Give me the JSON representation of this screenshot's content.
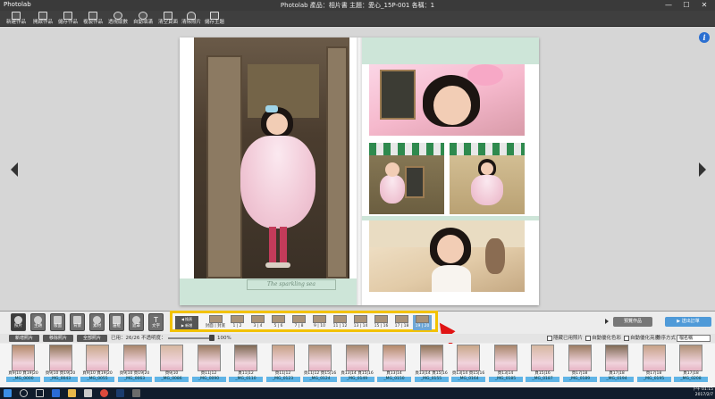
{
  "window": {
    "app_logo": "Photolab",
    "title": "Photolab    產品：相片書  主題：愛心_15P-001  各稱：1",
    "min": "—",
    "max": "☐",
    "close": "✕"
  },
  "toolbar": {
    "items": [
      {
        "label": "新建作品"
      },
      {
        "label": "開啟作品"
      },
      {
        "label": "儲存作品"
      },
      {
        "label": "複製作品"
      },
      {
        "label": "透視版數"
      },
      {
        "label": "自動填滿"
      },
      {
        "label": "清空頁面"
      },
      {
        "label": "清除照片"
      },
      {
        "label": "儲存主題"
      }
    ]
  },
  "album": {
    "caption": "The sparkling sea"
  },
  "side_tabs": [
    {
      "label": "照片"
    },
    {
      "label": "主題"
    },
    {
      "label": "版面"
    },
    {
      "label": "背景"
    },
    {
      "label": "素材"
    },
    {
      "label": "邊框"
    },
    {
      "label": "遮罩"
    },
    {
      "label": "文字"
    }
  ],
  "spread_strip": {
    "control_top": "◀ 換頁",
    "control_bottom": "▶ 新增",
    "items": [
      {
        "label": "封面 | 封底"
      },
      {
        "label": "1 | 2"
      },
      {
        "label": "3 | 4"
      },
      {
        "label": "5 | 6"
      },
      {
        "label": "7 | 8"
      },
      {
        "label": "9 | 10"
      },
      {
        "label": "11 | 12"
      },
      {
        "label": "13 | 14"
      },
      {
        "label": "15 | 16"
      },
      {
        "label": "17 | 18"
      },
      {
        "label": "19 | 20"
      }
    ]
  },
  "right_controls": {
    "preview_label": "預覽作品",
    "order_label": "▶ 送出訂單"
  },
  "filter_row": {
    "btn_add": "新增照片",
    "btn_remove": "移除照片",
    "btn_sort": "全部照片",
    "used_count": "已用：26/26",
    "opacity_label": "不透明度：",
    "opacity_value": "100%",
    "hide_used": "隱藏已用照片",
    "auto_color": "自動優化色彩",
    "auto_bright": "自動優化亮度",
    "sort_label": "排序方式",
    "sort_value": "檔名稱"
  },
  "photos": [
    {
      "usage": "頁9|10 頁19|20",
      "name": "_MG_0000"
    },
    {
      "usage": "頁9|10 頁19|20",
      "name": "_MG_0043"
    },
    {
      "usage": "頁9|10 頁19|20",
      "name": "_MG_0055"
    },
    {
      "usage": "頁9|10 頁19|20",
      "name": "_MG_0063"
    },
    {
      "usage": "頁9|10",
      "name": "_MG_0086"
    },
    {
      "usage": "頁11|12",
      "name": "_MG_0090"
    },
    {
      "usage": "頁11|12",
      "name": "_MG_0110"
    },
    {
      "usage": "頁11|12",
      "name": "_MG_0123"
    },
    {
      "usage": "頁11|12 頁15|16",
      "name": "_MG_0124"
    },
    {
      "usage": "頁13|14 頁15|16",
      "name": "_MG_0149"
    },
    {
      "usage": "頁13|14",
      "name": "_MG_0150"
    },
    {
      "usage": "頁13|14 頁15|16",
      "name": "_MG_0155"
    },
    {
      "usage": "頁13|14 頁15|16",
      "name": "_MG_0164"
    },
    {
      "usage": "頁13|14",
      "name": "_MG_0185"
    },
    {
      "usage": "頁15|16",
      "name": "_MG_0187"
    },
    {
      "usage": "頁17|18",
      "name": "_MG_0189"
    },
    {
      "usage": "頁17|18",
      "name": "_MG_0194"
    },
    {
      "usage": "頁17|18",
      "name": "_MG_0195"
    },
    {
      "usage": "頁17|18",
      "name": "_MG_0208"
    }
  ],
  "taskbar": {
    "time": "下午 01:15",
    "date": "2017/2/7"
  }
}
